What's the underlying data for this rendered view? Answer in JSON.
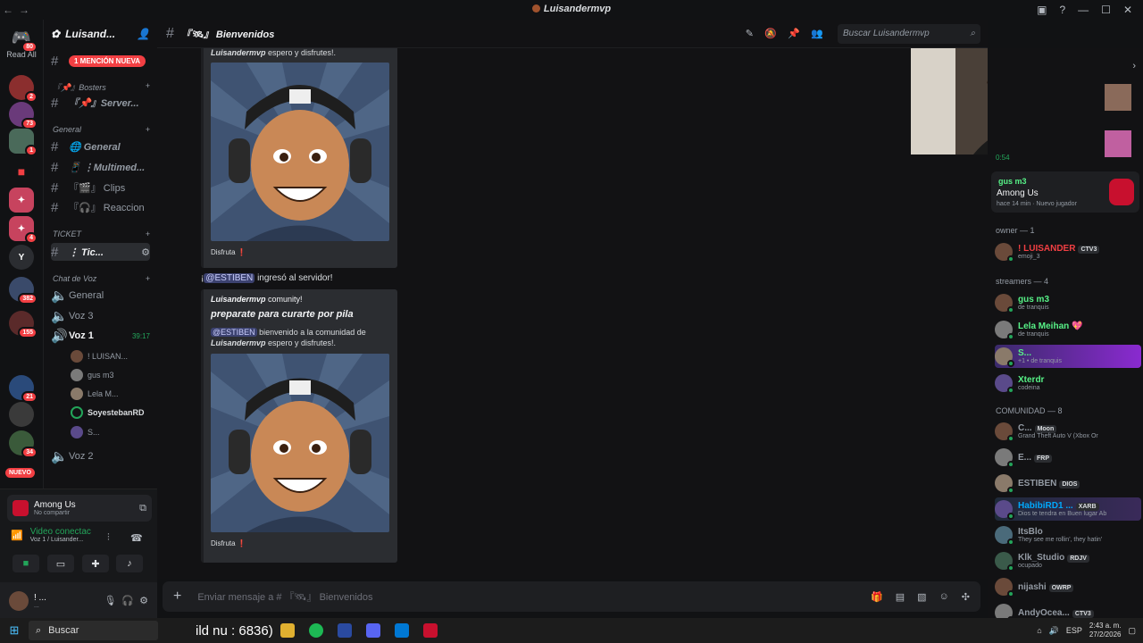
{
  "window": {
    "title": "Luisandermvp",
    "nav_back": "←",
    "nav_forward": "→"
  },
  "guilds": {
    "read_all": "Read All",
    "badges": [
      "80",
      "2",
      "73",
      "1",
      "4",
      "382",
      "155",
      "21",
      "34"
    ],
    "nuevo": "NUEVO"
  },
  "server": {
    "name": "Luisand...",
    "mention_banner": "1 MENCIÓN NUEVA"
  },
  "channels": {
    "categories": {
      "bosters": "『📌』Bosters",
      "general": "General",
      "ticket": "TICKET",
      "voz": "Chat de Voz"
    },
    "text": [
      {
        "name": "『📌』Server...",
        "id": "server"
      },
      {
        "name": "🌐 General",
        "id": "general"
      },
      {
        "name": "📱 ⋮Multimed...",
        "id": "multimedia"
      },
      {
        "name": "『🎬』 Clips",
        "id": "clips"
      },
      {
        "name": "『🎧』 Reaccion",
        "id": "reaccion"
      },
      {
        "name": "⋮ Tic...",
        "id": "ticket"
      }
    ],
    "voice": [
      {
        "name": "General"
      },
      {
        "name": "Voz 3"
      },
      {
        "name": "Voz 1",
        "timer": "39:17"
      },
      {
        "name": "Voz 2"
      }
    ],
    "voice_users": [
      "! LUISAN...",
      "gus m3",
      "Lela M...",
      "SoyestebanRD",
      "S..."
    ]
  },
  "activity": {
    "game": "Among Us",
    "sub": "No compartir"
  },
  "voice_status": {
    "title": "Video conectac",
    "sub": "Voz 1 / Luisander..."
  },
  "user": {
    "name": "! ...",
    "sub": "..."
  },
  "chat": {
    "channel_name": "『🛰』 Bienvenidos",
    "search_placeholder": "Buscar Luisandermvp",
    "msg1_tail": {
      "bold": "Luisandermvp",
      "text": " espero y disfrutes!."
    },
    "msg1_footer": "Disfruta ❗",
    "join": {
      "prefix": "¡",
      "mention": "@ESTIBEN",
      "text": " ingresó al servidor!"
    },
    "embed2": {
      "author_bold": "Luisandermvp",
      "author_text": " comunity!",
      "title": "preparate para curarte por pila",
      "mention": "@ESTIBEN",
      "desc": " bienvenido a la comunidad de ",
      "desc_bold": "Luisandermvp",
      "desc_tail": " espero y disfrutes!.",
      "footer": "Disfruta ❗"
    },
    "composer_placeholder": "Enviar mensaje a # 『🛰』 Bienvenidos"
  },
  "members": {
    "stream_timer": "0:54",
    "now_playing": {
      "name": "gus m3",
      "game": "Among Us",
      "time": "hace 14 min",
      "status": "Nuevo jugador"
    },
    "groups": {
      "owner": "owner — 1",
      "streamers": "streamers — 4",
      "comunidad": "COMUNIDAD — 8"
    },
    "owner": [
      {
        "name": "! LUISANDER",
        "tag": "CTV3",
        "sub": "emoji_3",
        "color": "#f23f43"
      }
    ],
    "streamers": [
      {
        "name": "gus m3",
        "sub": "de tranquis",
        "color": "#57f287"
      },
      {
        "name": "Lela Meihan 💖",
        "sub": "de tranquis",
        "color": "#57f287"
      },
      {
        "name": "S...",
        "sub": "+1 • de tranquis",
        "color": "#57f287"
      },
      {
        "name": "Xterdr",
        "sub": "codeina",
        "color": "#57f287"
      }
    ],
    "comunidad": [
      {
        "name": "C...",
        "tag": "Moon",
        "sub": "Grand Theft Auto V (Xbox Or",
        "color": "#949ba4"
      },
      {
        "name": "E...",
        "tag": "FRP",
        "sub": "",
        "color": "#949ba4"
      },
      {
        "name": "ESTIBEN",
        "tag": "DIOS",
        "sub": "",
        "color": "#949ba4"
      },
      {
        "name": "HabibiRD1 ...",
        "tag": "XARB",
        "sub": "Dios te tendra en Buen lugar Ab",
        "color": "#00a8fc"
      },
      {
        "name": "ItsBlo",
        "tag": "",
        "sub": "They see me rollin', they hatin'",
        "color": "#949ba4"
      },
      {
        "name": "Klk_Studio",
        "tag": "RDJV",
        "sub": "ocupado",
        "color": "#949ba4"
      },
      {
        "name": "nijashi",
        "tag": "OWRP",
        "sub": "",
        "color": "#949ba4"
      },
      {
        "name": "AndyOcea...",
        "tag": "CTV3",
        "sub": "",
        "color": "#949ba4"
      }
    ]
  },
  "taskbar": {
    "search": "Buscar",
    "overlay_text": "ild nu : 6836)",
    "lang": "ESP",
    "time": "2:43 a. m.",
    "date": "27/2/2026"
  }
}
